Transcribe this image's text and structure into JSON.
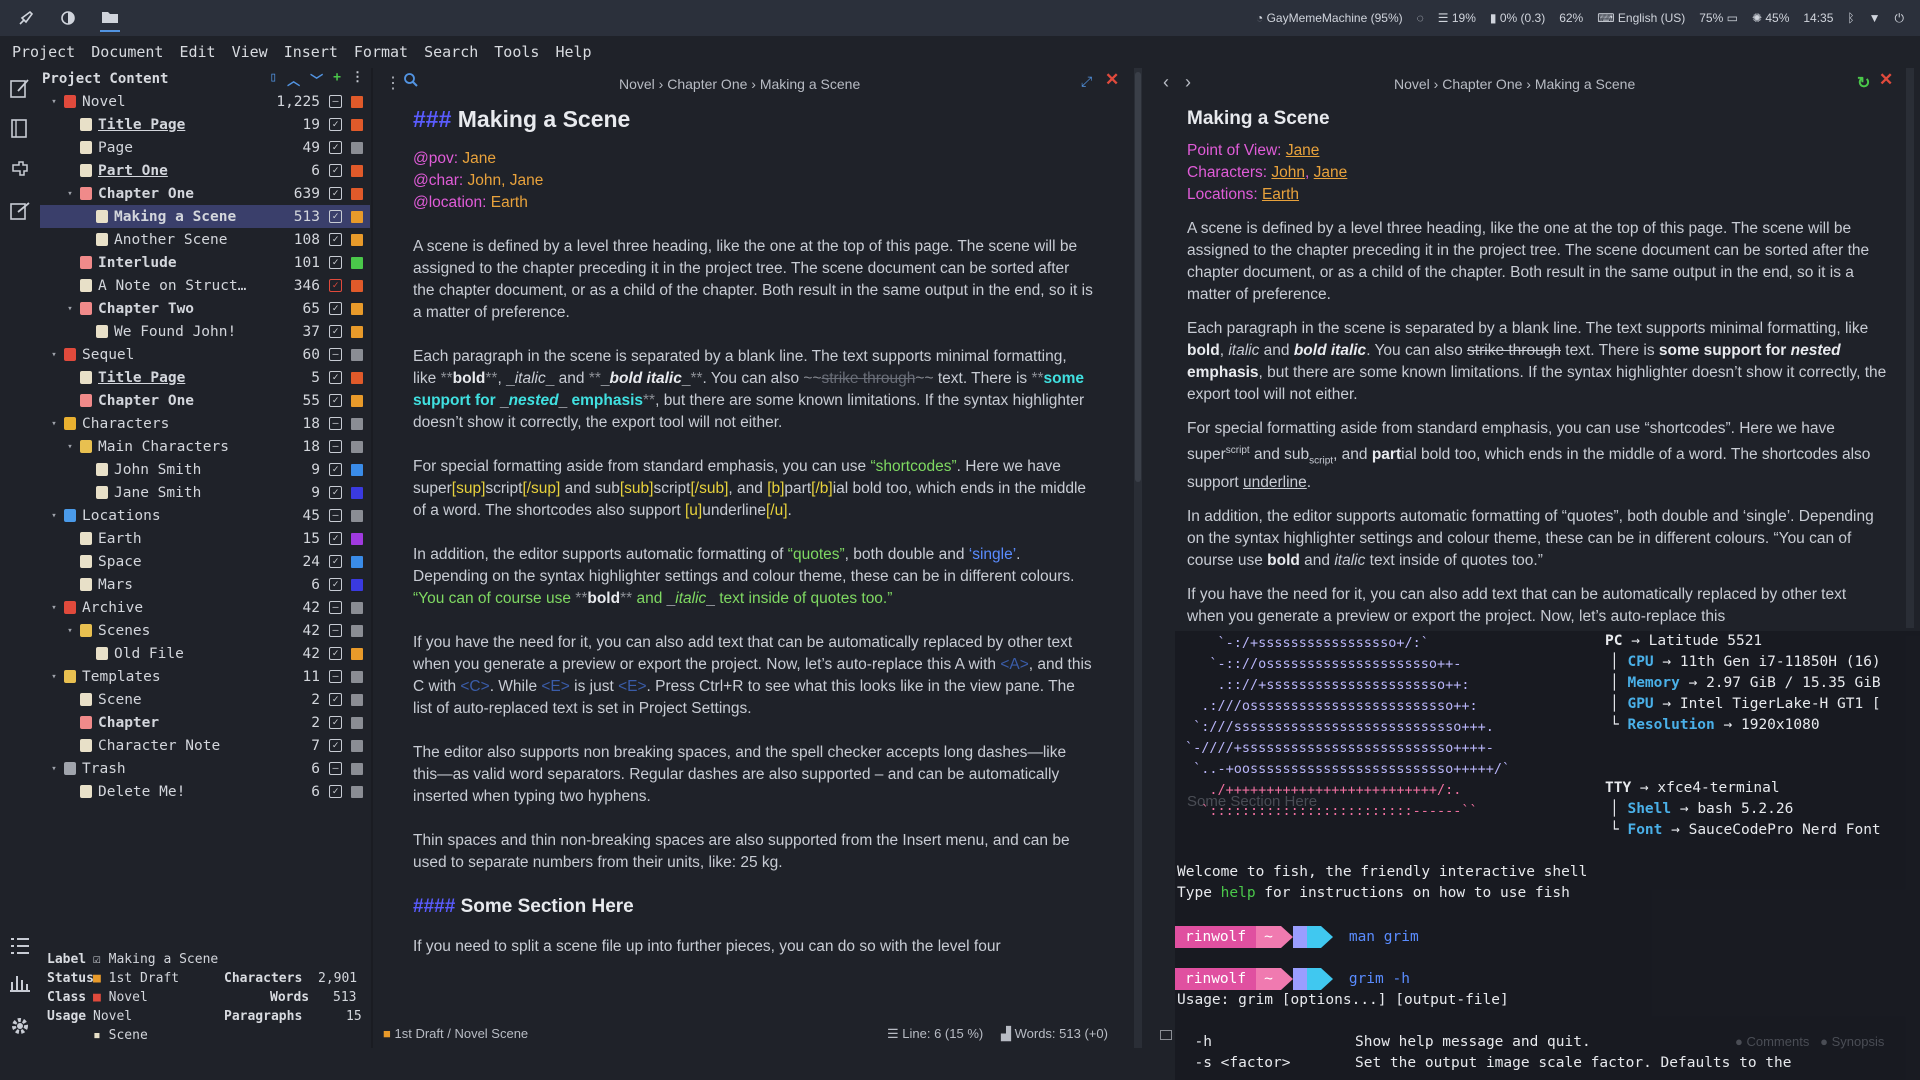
{
  "topbar": {
    "wifi": "GayMemeMachine (95%)",
    "cpu": "19%",
    "disk": "0% (0.3)",
    "mem": "62%",
    "keyboard": "English (US)",
    "battery": "75%",
    "brightness": "45%",
    "time": "14:35"
  },
  "menu": [
    "Project",
    "Document",
    "Edit",
    "View",
    "Insert",
    "Format",
    "Search",
    "Tools",
    "Help"
  ],
  "tree": {
    "title": "Project Content",
    "rows": [
      {
        "label": "Novel",
        "count": "1,225",
        "level": 0,
        "chev": "▾",
        "icon": "#e04a3c",
        "check": "minus",
        "sq": "#e05a2a",
        "style": ""
      },
      {
        "label": "Title Page",
        "count": "19",
        "level": 1,
        "chev": "",
        "icon": "#e8e0c8",
        "check": "yes",
        "sq": "#e05a2a",
        "style": "u"
      },
      {
        "label": "Page",
        "count": "49",
        "level": 1,
        "chev": "",
        "icon": "#e8e0c8",
        "check": "yes",
        "sq": "#8a8d94",
        "style": ""
      },
      {
        "label": "Part One",
        "count": "6",
        "level": 1,
        "chev": "",
        "icon": "#e8e0c8",
        "check": "yes",
        "sq": "#e05a2a",
        "style": "u"
      },
      {
        "label": "Chapter One",
        "count": "639",
        "level": 1,
        "chev": "▾",
        "icon": "#f08a8a",
        "check": "yes",
        "sq": "#e05a2a",
        "style": "b"
      },
      {
        "label": "Making a Scene",
        "count": "513",
        "level": 2,
        "chev": "",
        "icon": "#e8e0c8",
        "check": "yes",
        "sq": "#e89a2a",
        "style": "b",
        "selected": true
      },
      {
        "label": "Another Scene",
        "count": "108",
        "level": 2,
        "chev": "",
        "icon": "#e8e0c8",
        "check": "yes",
        "sq": "#e89a2a",
        "style": ""
      },
      {
        "label": "Interlude",
        "count": "101",
        "level": 1,
        "chev": "",
        "icon": "#f08a8a",
        "check": "yes",
        "sq": "#4ac84a",
        "style": "b"
      },
      {
        "label": "A Note on Struct…",
        "count": "346",
        "level": 1,
        "chev": "",
        "icon": "#e8e0c8",
        "check": "red",
        "sq": "#e05a2a",
        "style": ""
      },
      {
        "label": "Chapter Two",
        "count": "65",
        "level": 1,
        "chev": "▾",
        "icon": "#f08a8a",
        "check": "yes",
        "sq": "#e89a2a",
        "style": "b"
      },
      {
        "label": "We Found John!",
        "count": "37",
        "level": 2,
        "chev": "",
        "icon": "#e8e0c8",
        "check": "yes",
        "sq": "#e89a2a",
        "style": ""
      },
      {
        "label": "Sequel",
        "count": "60",
        "level": 0,
        "chev": "▾",
        "icon": "#e04a3c",
        "check": "minus",
        "sq": "#8a8d94",
        "style": ""
      },
      {
        "label": "Title Page",
        "count": "5",
        "level": 1,
        "chev": "",
        "icon": "#e8e0c8",
        "check": "yes",
        "sq": "#e05a2a",
        "style": "u"
      },
      {
        "label": "Chapter One",
        "count": "55",
        "level": 1,
        "chev": "",
        "icon": "#f08a8a",
        "check": "yes",
        "sq": "#e89a2a",
        "style": "b"
      },
      {
        "label": "Characters",
        "count": "18",
        "level": 0,
        "chev": "▾",
        "icon": "#e8b030",
        "check": "minus",
        "sq": "#8a8d94",
        "style": ""
      },
      {
        "label": "Main Characters",
        "count": "18",
        "level": 1,
        "chev": "▾",
        "icon": "#e8c050",
        "check": "minus",
        "sq": "#8a8d94",
        "style": ""
      },
      {
        "label": "John Smith",
        "count": "9",
        "level": 2,
        "chev": "",
        "icon": "#e8e0c8",
        "check": "yes",
        "sq": "#3a8ce8",
        "style": ""
      },
      {
        "label": "Jane Smith",
        "count": "9",
        "level": 2,
        "chev": "",
        "icon": "#e8e0c8",
        "check": "yes",
        "sq": "#3a3ae0",
        "style": ""
      },
      {
        "label": "Locations",
        "count": "45",
        "level": 0,
        "chev": "▾",
        "icon": "#4a9ae8",
        "check": "minus",
        "sq": "#8a8d94",
        "style": ""
      },
      {
        "label": "Earth",
        "count": "15",
        "level": 1,
        "chev": "",
        "icon": "#e8e0c8",
        "check": "yes",
        "sq": "#a03ae0",
        "style": ""
      },
      {
        "label": "Space",
        "count": "24",
        "level": 1,
        "chev": "",
        "icon": "#e8e0c8",
        "check": "yes",
        "sq": "#3a8ce8",
        "style": ""
      },
      {
        "label": "Mars",
        "count": "6",
        "level": 1,
        "chev": "",
        "icon": "#e8e0c8",
        "check": "yes",
        "sq": "#3a3ae0",
        "style": ""
      },
      {
        "label": "Archive",
        "count": "42",
        "level": 0,
        "chev": "▾",
        "icon": "#e04a3c",
        "check": "minus",
        "sq": "#8a8d94",
        "style": ""
      },
      {
        "label": "Scenes",
        "count": "42",
        "level": 1,
        "chev": "▾",
        "icon": "#e8c050",
        "check": "minus",
        "sq": "#8a8d94",
        "style": ""
      },
      {
        "label": "Old File",
        "count": "42",
        "level": 2,
        "chev": "",
        "icon": "#e8e0c8",
        "check": "yes",
        "sq": "#e89a2a",
        "style": ""
      },
      {
        "label": "Templates",
        "count": "11",
        "level": 0,
        "chev": "▾",
        "icon": "#e8c050",
        "check": "minus",
        "sq": "#8a8d94",
        "style": ""
      },
      {
        "label": "Scene",
        "count": "2",
        "level": 1,
        "chev": "",
        "icon": "#e8e0c8",
        "check": "yes",
        "sq": "#8a8d94",
        "style": ""
      },
      {
        "label": "Chapter",
        "count": "2",
        "level": 1,
        "chev": "",
        "icon": "#f08a8a",
        "check": "yes",
        "sq": "#8a8d94",
        "style": "b"
      },
      {
        "label": "Character Note",
        "count": "7",
        "level": 1,
        "chev": "",
        "icon": "#e8e0c8",
        "check": "yes",
        "sq": "#8a8d94",
        "style": ""
      },
      {
        "label": "Trash",
        "count": "6",
        "level": 0,
        "chev": "▾",
        "icon": "#a0a4ac",
        "check": "minus",
        "sq": "#8a8d94",
        "style": ""
      },
      {
        "label": "Delete Me!",
        "count": "6",
        "level": 1,
        "chev": "",
        "icon": "#e8e0c8",
        "check": "yes",
        "sq": "#8a8d94",
        "style": ""
      }
    ]
  },
  "details": {
    "label_k": "Label",
    "label_v": "Making a Scene",
    "status_k": "Status",
    "status_v": "1st Draft",
    "class_k": "Class",
    "class_v": "Novel",
    "usage_k": "Usage",
    "usage_v1": "Novel",
    "usage_v2": "Scene",
    "chars_k": "Characters",
    "chars_v": "2,901",
    "words_k": "Words",
    "words_v": "513",
    "paras_k": "Paragraphs",
    "paras_v": "15"
  },
  "editor": {
    "crumb": "Novel  ›  Chapter One  ›  Making a Scene",
    "h3_hash": "###",
    "h3": "Making a Scene",
    "pov_k": "@pov:",
    "pov_v": "Jane",
    "char_k": "@char:",
    "char_v": "John, Jane",
    "loc_k": "@location:",
    "loc_v": "Earth",
    "p1": "A scene is defined by a level three heading, like the one at the top of this page. The scene will be assigned to the chapter preceding it in the project tree. The scene document can be sorted after the chapter document, or as a child of the chapter. Both result in the same output in the end, so it is a matter of preference.",
    "p2a": "Each paragraph in the scene is separated by a blank line. The text supports minimal formatting, like ",
    "p2_bold": "bold",
    "p2b": ", ",
    "p2_italic": "italic",
    "p2c": " and ",
    "p2_bi": "bold italic",
    "p2d": ". You can also ",
    "p2_strike": "strike through",
    "p2e": " text. There is ",
    "p2_some": "some support for ",
    "p2_nested": "nested",
    "p2_emph": " emphasis",
    "p2f": ", but there are some known limitations. If the syntax highlighter doesn’t show it correctly, the export tool will not either.",
    "p3a": "For special formatting aside from standard emphasis, you can use ",
    "p3_short": "“shortcodes”",
    "p3b": ". Here we have super",
    "p3_sup1": "[sup]",
    "p3_script1": "script",
    "p3_sup2": "[/sup]",
    "p3c": " and sub",
    "p3_sub1": "[sub]",
    "p3_script2": "script",
    "p3_sub2": "[/sub]",
    "p3d": ", and ",
    "p3_b1": "[b]",
    "p3_part": "part",
    "p3_b2": "[/b]",
    "p3e": "ial bold too, which ends in the middle of a word. The shortcodes also support ",
    "p3_u1": "[u]",
    "p3_under": "underline",
    "p3_u2": "[/u]",
    "p3f": ".",
    "p4a": "In addition, the editor supports automatic formatting of ",
    "p4_quotes": "“quotes”",
    "p4b": ", both double and ",
    "p4_single": "‘single’",
    "p4c": ". Depending on the syntax highlighter settings and colour theme, these can be in different colours. ",
    "p4_q1": "“You can of course use ",
    "p4_bold": "bold",
    "p4_q2": " and ",
    "p4_italic": "italic",
    "p4_q3": " text inside of quotes too.”",
    "p5a": "If you have the need for it, you can also add text that can be automatically replaced by other text when you generate a preview or export the project. Now, let’s auto-replace this A with ",
    "p5_A": "<A>",
    "p5b": ", and this C with ",
    "p5_C": "<C>",
    "p5c": ". While ",
    "p5_E1": "<E>",
    "p5d": " is just ",
    "p5_E2": "<E>",
    "p5e": ". Press Ctrl+R to see what this looks like in the view pane. The list of auto-replaced text is set in Project Settings.",
    "p6": "The editor also supports non breaking spaces, and the spell checker accepts long dashes—like this—as valid word separators. Regular dashes are also supported – and can be automatically inserted when typing two hyphens.",
    "p7": "Thin spaces and thin non-breaking spaces are also supported from the Insert menu, and can be used to separate numbers from their units, like: 25 kg.",
    "h4_hash": "####",
    "h4": "Some Section Here",
    "p8": "If you need to split a scene file up into further pieces, you can do so with the level four",
    "status_left": "1st Draft / Novel Scene",
    "status_line": "Line: 6 (15 %)",
    "status_words": "Words: 513 (+0)"
  },
  "viewer": {
    "crumb": "Novel  ›  Chapter One  ›  Making a Scene",
    "title": "Making a Scene",
    "pov_k": "Point of View: ",
    "pov_v": "Jane",
    "char_k": "Characters: ",
    "char_v1": "John",
    "char_v2": "Jane",
    "loc_k": "Locations: ",
    "loc_v": "Earth",
    "p1": "A scene is defined by a level three heading, like the one at the top of this page. The scene will be assigned to the chapter preceding it in the project tree. The scene document can be sorted after the chapter document, or as a child of the chapter. Both result in the same output in the end, so it is a matter of preference.",
    "p2a": "Each paragraph in the scene is separated by a blank line. The text supports minimal formatting, like ",
    "p2_bold": "bold",
    "p2b": ", ",
    "p2_italic": "italic",
    "p2c": " and ",
    "p2_bi": "bold italic",
    "p2d": ". You can also ",
    "p2_strike": "strike through",
    "p2e": " text. There is ",
    "p2_some": "some support for ",
    "p2_nested": "nested",
    "p2_emph": " emphasis",
    "p2f": ", but there are some known limitations. If the syntax highlighter doesn’t show it correctly, the export tool will not either.",
    "p3a": "For special formatting aside from standard emphasis, you can use “shortcodes”. Here we have super",
    "p3_sup": "script",
    "p3b": " and sub",
    "p3_sub": "script",
    "p3c": ", and ",
    "p3_part": "part",
    "p3d": "ial bold too, which ends in the middle of a word. The shortcodes also support ",
    "p3_u": "underline",
    "p3e": ".",
    "p4a": "In addition, the editor supports automatic formatting of “quotes”, both double and ‘single’. Depending on the syntax highlighter settings and colour theme, these can be in different colours. “You can of course use ",
    "p4_bold": "bold",
    "p4b": " and ",
    "p4_italic": "italic",
    "p4c": " text inside of quotes too.”",
    "p5": "If you have the need for it, you can also add text that can be automatically replaced by other text when you generate a preview or export the project. Now, let’s auto-replace this",
    "comments": "Comments",
    "synopsis": "Synopsis"
  },
  "terminal": {
    "art_lines": [
      "    `-:/+sssssssssssssssso+/:`",
      "   `-:://osssssssssssssssssssso++-",
      "    .:://+ssssssssssssssssssssso++:",
      "  .:///osssssssssssssssssssssssso++:",
      " `:///ssssssssssssssssssssssssssso+++.",
      "`-////+ssssssssssssssssssssssssso++++-",
      " `..-+oosssssssssssssssssssssssso+++++/`",
      "   ./++++++++++++++++++++++++++/:.",
      "  `:::::::::::::::::::::::::------``"
    ],
    "pc_k": "PC",
    "pc_v": "Latitude 5521",
    "cpu_k": "CPU",
    "cpu_v": "11th Gen i7-11850H (16)",
    "mem_k": "Memory",
    "mem_v": "2.97 GiB / 15.35 GiB",
    "gpu_k": "GPU",
    "gpu_v": "Intel TigerLake-H GT1 [",
    "res_k": "Resolution",
    "res_v": "1920x1080",
    "tty_k": "TTY",
    "tty_v": "xfce4-terminal",
    "shell_k": "Shell",
    "shell_v": "bash 5.2.26",
    "font_k": "Font",
    "font_v": "SauceCodePro Nerd Font",
    "welcome": "Welcome to fish, the friendly interactive shell",
    "type_a": "Type ",
    "type_help": "help",
    "type_b": " for instructions on how to use fish",
    "user": "rinwolf",
    "tilde": "~",
    "cmd1": "man grim",
    "cmd2": "grim -h",
    "usage": "Usage: grim [options...] [output-file]",
    "opt1_k": "  -h",
    "opt1_v": "Show help message and quit.",
    "opt2_k": "  -s <factor>",
    "opt2_v": "Set the output image scale factor. Defaults to the",
    "ghost_heading": "Some Section Here"
  }
}
